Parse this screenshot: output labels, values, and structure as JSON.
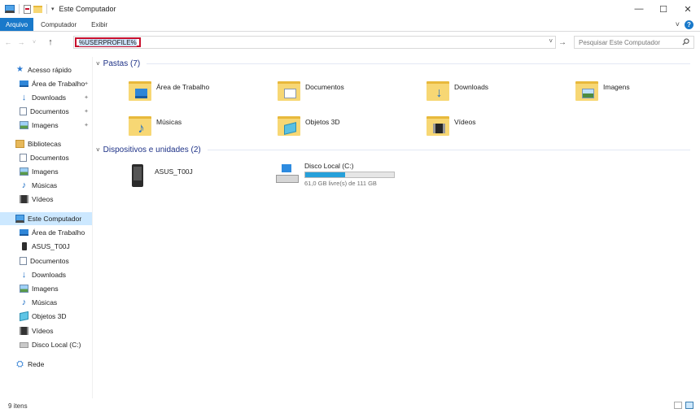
{
  "window": {
    "title": "Este Computador",
    "controls": {
      "minimize": "—",
      "maximize": "☐",
      "close": "✕"
    }
  },
  "ribbon": {
    "tabs": [
      {
        "label": "Arquivo"
      },
      {
        "label": "Computador"
      },
      {
        "label": "Exibir"
      }
    ],
    "expand_glyph": "˅",
    "help_glyph": "?"
  },
  "nav": {
    "back": "←",
    "forward": "→",
    "recent": "˅",
    "up": "↑"
  },
  "address": {
    "value": "%USERPROFILE%",
    "dropdown": "˅",
    "go": "→"
  },
  "search": {
    "placeholder": "Pesquisar Este Computador",
    "icon": "search-icon"
  },
  "sidebar": {
    "items": [
      {
        "label": "Acesso rápido",
        "icon": "star-icon",
        "indent": 0
      },
      {
        "label": "Área de Trabalho",
        "icon": "desktop-icon",
        "indent": 1,
        "pinned": true
      },
      {
        "label": "Downloads",
        "icon": "download-icon",
        "indent": 1,
        "pinned": true
      },
      {
        "label": "Documentos",
        "icon": "document-icon",
        "indent": 1,
        "pinned": true
      },
      {
        "label": "Imagens",
        "icon": "image-icon",
        "indent": 1,
        "pinned": true
      },
      {
        "label": "Bibliotecas",
        "icon": "library-icon",
        "indent": 0
      },
      {
        "label": "Documentos",
        "icon": "document-icon",
        "indent": 1
      },
      {
        "label": "Imagens",
        "icon": "image-icon",
        "indent": 1
      },
      {
        "label": "Músicas",
        "icon": "music-icon",
        "indent": 1
      },
      {
        "label": "Vídeos",
        "icon": "video-icon",
        "indent": 1
      },
      {
        "label": "Este Computador",
        "icon": "computer-icon",
        "indent": 0,
        "selected": true
      },
      {
        "label": "Área de Trabalho",
        "icon": "desktop-icon",
        "indent": 1
      },
      {
        "label": "ASUS_T00J",
        "icon": "phone-icon",
        "indent": 1
      },
      {
        "label": "Documentos",
        "icon": "document-icon",
        "indent": 1
      },
      {
        "label": "Downloads",
        "icon": "download-icon",
        "indent": 1
      },
      {
        "label": "Imagens",
        "icon": "image-icon",
        "indent": 1
      },
      {
        "label": "Músicas",
        "icon": "music-icon",
        "indent": 1
      },
      {
        "label": "Objetos 3D",
        "icon": "objects-3d-icon",
        "indent": 1
      },
      {
        "label": "Vídeos",
        "icon": "video-icon",
        "indent": 1
      },
      {
        "label": "Disco Local (C:)",
        "icon": "disk-icon",
        "indent": 1
      },
      {
        "label": "Rede",
        "icon": "network-icon",
        "indent": 0
      }
    ],
    "pin_glyph": "📌"
  },
  "content": {
    "folders_header": "Pastas (7)",
    "folders": [
      {
        "label": "Área de Trabalho",
        "badge": "desktop"
      },
      {
        "label": "Documentos",
        "badge": "document"
      },
      {
        "label": "Downloads",
        "badge": "download"
      },
      {
        "label": "Imagens",
        "badge": "image"
      },
      {
        "label": "Músicas",
        "badge": "music"
      },
      {
        "label": "Objetos 3D",
        "badge": "objects-3d"
      },
      {
        "label": "Vídeos",
        "badge": "video"
      }
    ],
    "devices_header": "Dispositivos e unidades (2)",
    "devices": [
      {
        "label": "ASUS_T00J",
        "icon": "phone-icon"
      },
      {
        "label": "Disco Local (C:)",
        "icon": "disk-icon",
        "free_text": "61,0 GB livre(s) de 111 GB",
        "used_fraction": 0.45
      }
    ]
  },
  "status": {
    "item_count": "9 itens"
  },
  "colors": {
    "accent": "#1979ca",
    "selection": "#cce8ff",
    "group_header": "#1e3287",
    "disk_fill": "#26a0da",
    "highlight_box": "#c8102e"
  }
}
